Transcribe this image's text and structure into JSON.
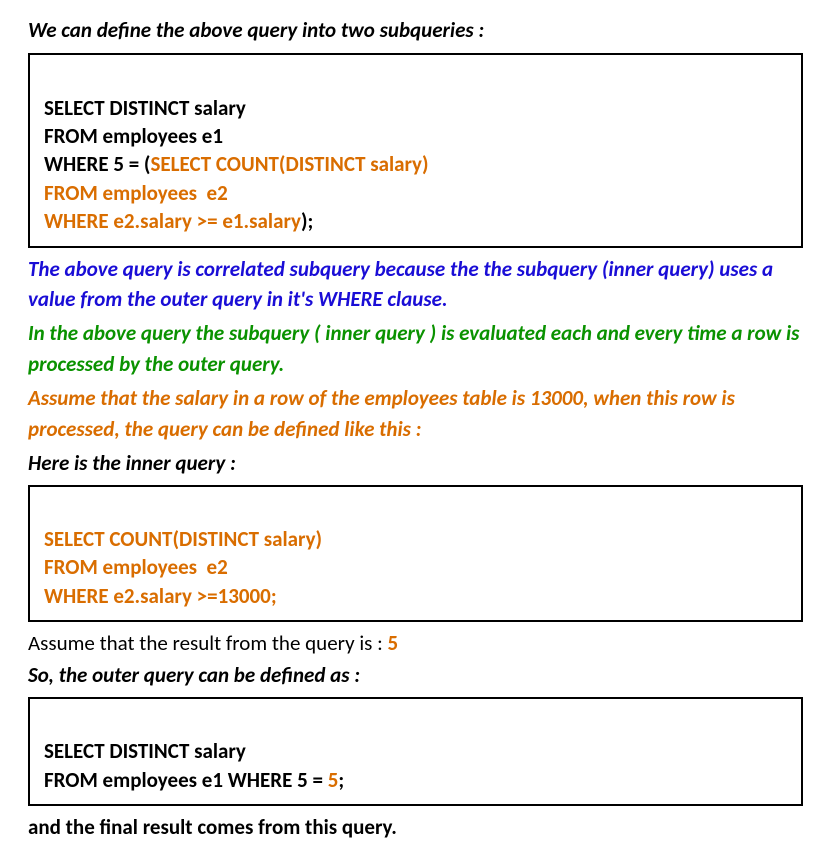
{
  "intro": "We can define the above query into two subqueries :",
  "box1": {
    "line1": "SELECT DISTINCT salary",
    "line2": "FROM employees e1",
    "line3_black": "WHERE 5 = (",
    "line3_orange": "SELECT COUNT(DISTINCT salary)",
    "line4": "FROM employees  e2",
    "line5_orange": "WHERE e2.salary >= e1.salary",
    "line5_black": ");"
  },
  "note_blue": "The above query is correlated subquery because the the subquery (inner query) uses a value from the outer query in it's WHERE clause.",
  "note_green": "In the above query the subquery ( inner query ) is evaluated each and every time a row is processed by the outer query.",
  "note_orange": "Assume that the salary in a row of the employees table is 13000, when this row is processed, the query can be defined  like this :",
  "inner_label": "Here is the inner query :",
  "box2": {
    "line1": "SELECT COUNT(DISTINCT salary)",
    "line2": "FROM employees  e2",
    "line3": "WHERE e2.salary >=13000;"
  },
  "assume_prefix": "Assume that the result from the query is : ",
  "assume_value": "5",
  "outer_label": "So, the outer query can be defined as :",
  "box3": {
    "line1": "SELECT DISTINCT salary",
    "line2_black": "FROM employees e1 WHERE 5 = ",
    "line2_orange": "5",
    "line2_end": ";"
  },
  "final_text": "and the final result comes from this query."
}
